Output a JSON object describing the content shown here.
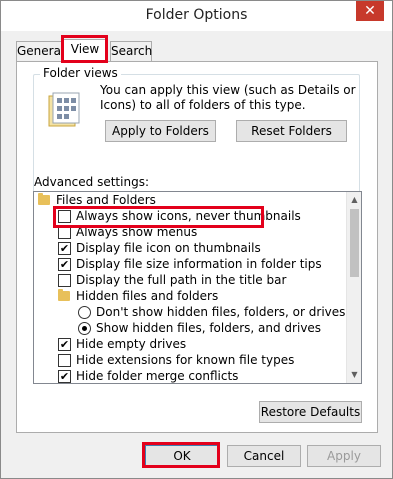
{
  "window": {
    "title": "Folder Options",
    "close_glyph": "✕"
  },
  "tabs": [
    {
      "label": "General"
    },
    {
      "label": "View",
      "active": true
    },
    {
      "label": "Search"
    }
  ],
  "folder_views": {
    "label": "Folder views",
    "description": "You can apply this view (such as Details or Icons) to all of folders of this type.",
    "apply_button": "Apply to Folders",
    "reset_button": "Reset Folders",
    "icon": "folder-view-icon"
  },
  "advanced": {
    "label": "Advanced settings:",
    "items": [
      {
        "kind": "folder",
        "label": "Files and Folders",
        "indent": 0
      },
      {
        "kind": "checkbox",
        "label": "Always show icons, never thumbnails",
        "checked": false,
        "indent": 1
      },
      {
        "kind": "checkbox",
        "label": "Always show menus",
        "checked": false,
        "indent": 1
      },
      {
        "kind": "checkbox",
        "label": "Display file icon on thumbnails",
        "checked": true,
        "indent": 1
      },
      {
        "kind": "checkbox",
        "label": "Display file size information in folder tips",
        "checked": true,
        "indent": 1
      },
      {
        "kind": "checkbox",
        "label": "Display the full path in the title bar",
        "checked": false,
        "indent": 1
      },
      {
        "kind": "folder",
        "label": "Hidden files and folders",
        "indent": 1
      },
      {
        "kind": "radio",
        "label": "Don't show hidden files, folders, or drives",
        "checked": false,
        "indent": 2
      },
      {
        "kind": "radio",
        "label": "Show hidden files, folders, and drives",
        "checked": true,
        "indent": 2
      },
      {
        "kind": "checkbox",
        "label": "Hide empty drives",
        "checked": true,
        "indent": 1
      },
      {
        "kind": "checkbox",
        "label": "Hide extensions for known file types",
        "checked": false,
        "indent": 1
      },
      {
        "kind": "checkbox",
        "label": "Hide folder merge conflicts",
        "checked": true,
        "indent": 1
      }
    ],
    "restore_button": "Restore Defaults"
  },
  "footer": {
    "ok": "OK",
    "cancel": "Cancel",
    "apply": "Apply"
  },
  "colors": {
    "highlight": "#e3001b",
    "close": "#c7392b"
  }
}
